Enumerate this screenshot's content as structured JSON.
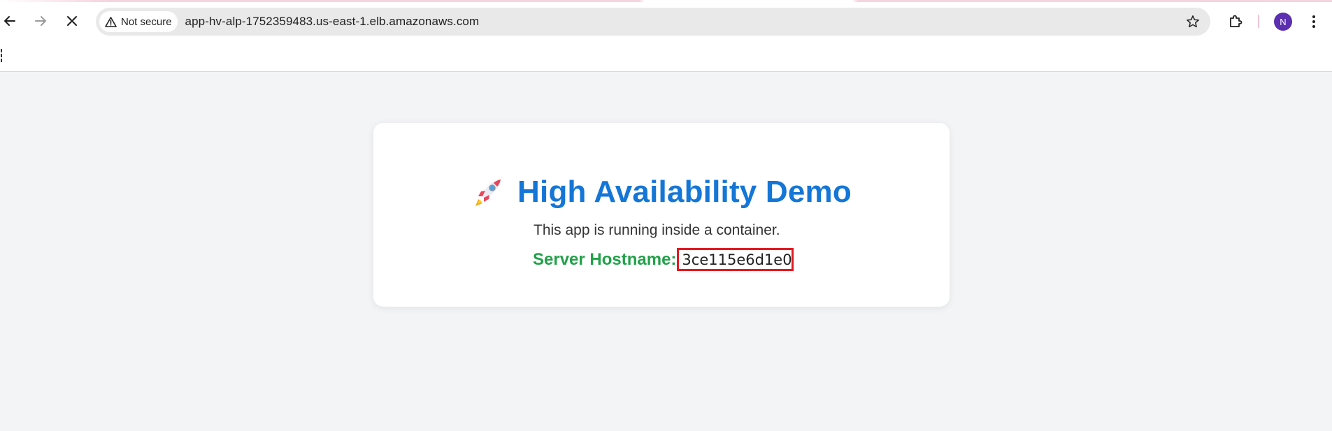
{
  "browser": {
    "security_label": "Not secure",
    "url": "app-hv-alp-1752359483.us-east-1.elb.amazonaws.com",
    "profile_initial": "N",
    "icons": {
      "back": "arrow-left-icon",
      "forward": "arrow-right-icon",
      "stop": "close-icon",
      "security": "warning-triangle-icon",
      "bookmark": "star-icon",
      "extensions": "puzzle-icon",
      "menu": "kebab-menu-icon"
    },
    "colors": {
      "avatar": "#5b2fb0",
      "omnibox": "#e9e9ea"
    }
  },
  "page": {
    "title_emoji": "rocket-icon",
    "title": "High Availability Demo",
    "subtitle": "This app is running inside a container.",
    "hostname_label": "Server Hostname:",
    "hostname_value": "3ce115e6d1e0",
    "colors": {
      "title": "#1476d6",
      "label": "#22a14a",
      "highlight_box": "#e01b22",
      "background": "#f3f4f6"
    }
  }
}
